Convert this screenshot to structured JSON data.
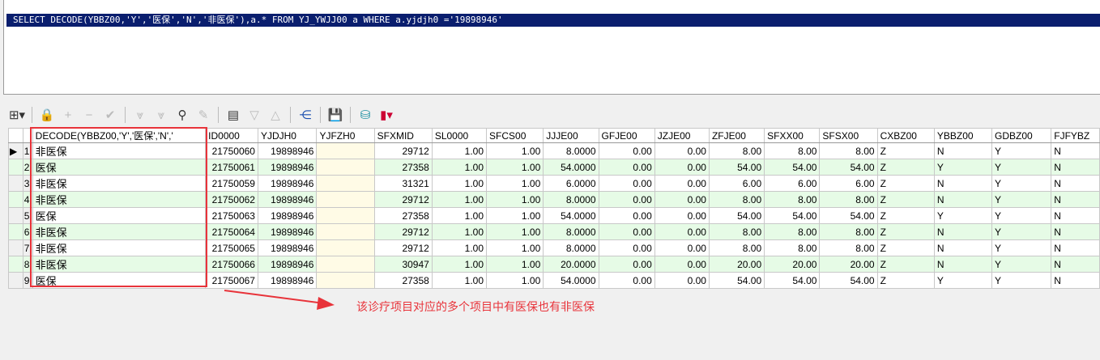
{
  "sql": "SELECT DECODE(YBBZ00,'Y','医保','N','非医保'),a.* FROM YJ_YWJJ00 a WHERE a.yjdjh0 ='19898946'",
  "toolbar": [
    "grid-layout",
    "lock",
    "add",
    "remove",
    "post",
    "next",
    "last",
    "find",
    "clear",
    "query",
    "filter-down",
    "filter-up",
    "tree",
    "save",
    "database",
    "chart"
  ],
  "columns": [
    "DECODE(YBBZ00,'Y','医保','N','",
    "ID0000",
    "YJDJH0",
    "YJFZH0",
    "SFXMID",
    "SL0000",
    "SFCS00",
    "JJJE00",
    "GFJE00",
    "JZJE00",
    "ZFJE00",
    "SFXX00",
    "SFSX00",
    "CXBZ00",
    "YBBZ00",
    "GDBZ00",
    "FJFYBZ"
  ],
  "rows": [
    [
      "1",
      "非医保",
      "21750060",
      "19898946",
      "",
      "29712",
      "1.00",
      "1.00",
      "8.0000",
      "0.00",
      "0.00",
      "8.00",
      "8.00",
      "8.00",
      "Z",
      "N",
      "Y",
      "N"
    ],
    [
      "2",
      "医保",
      "21750061",
      "19898946",
      "",
      "27358",
      "1.00",
      "1.00",
      "54.0000",
      "0.00",
      "0.00",
      "54.00",
      "54.00",
      "54.00",
      "Z",
      "Y",
      "Y",
      "N"
    ],
    [
      "3",
      "非医保",
      "21750059",
      "19898946",
      "",
      "31321",
      "1.00",
      "1.00",
      "6.0000",
      "0.00",
      "0.00",
      "6.00",
      "6.00",
      "6.00",
      "Z",
      "N",
      "Y",
      "N"
    ],
    [
      "4",
      "非医保",
      "21750062",
      "19898946",
      "",
      "29712",
      "1.00",
      "1.00",
      "8.0000",
      "0.00",
      "0.00",
      "8.00",
      "8.00",
      "8.00",
      "Z",
      "N",
      "Y",
      "N"
    ],
    [
      "5",
      "医保",
      "21750063",
      "19898946",
      "",
      "27358",
      "1.00",
      "1.00",
      "54.0000",
      "0.00",
      "0.00",
      "54.00",
      "54.00",
      "54.00",
      "Z",
      "Y",
      "Y",
      "N"
    ],
    [
      "6",
      "非医保",
      "21750064",
      "19898946",
      "",
      "29712",
      "1.00",
      "1.00",
      "8.0000",
      "0.00",
      "0.00",
      "8.00",
      "8.00",
      "8.00",
      "Z",
      "N",
      "Y",
      "N"
    ],
    [
      "7",
      "非医保",
      "21750065",
      "19898946",
      "",
      "29712",
      "1.00",
      "1.00",
      "8.0000",
      "0.00",
      "0.00",
      "8.00",
      "8.00",
      "8.00",
      "Z",
      "N",
      "Y",
      "N"
    ],
    [
      "8",
      "非医保",
      "21750066",
      "19898946",
      "",
      "30947",
      "1.00",
      "1.00",
      "20.0000",
      "0.00",
      "0.00",
      "20.00",
      "20.00",
      "20.00",
      "Z",
      "N",
      "Y",
      "N"
    ],
    [
      "9",
      "医保",
      "21750067",
      "19898946",
      "",
      "27358",
      "1.00",
      "1.00",
      "54.0000",
      "0.00",
      "0.00",
      "54.00",
      "54.00",
      "54.00",
      "Z",
      "Y",
      "Y",
      "N"
    ]
  ],
  "annotation": "该诊疗项目对应的多个项目中有医保也有非医保",
  "colors": {
    "accent": "#e8333a",
    "sql_bg": "#0a1e6e",
    "alt_row": "#e6fbe6"
  }
}
